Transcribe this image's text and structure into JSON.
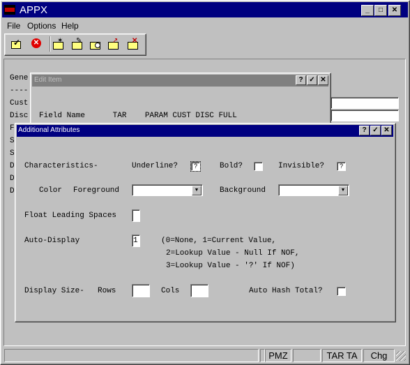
{
  "window": {
    "title": "APPX",
    "icon": "appx-logo-icon"
  },
  "menu": [
    {
      "label": "File"
    },
    {
      "label": "Options"
    },
    {
      "label": "Help"
    }
  ],
  "toolbar": [
    {
      "name": "ok-tool-icon"
    },
    {
      "name": "cancel-tool-icon"
    },
    {
      "name": "new-folder-icon"
    },
    {
      "name": "edit-folder-icon"
    },
    {
      "name": "search-folder-icon"
    },
    {
      "name": "up-folder-icon"
    },
    {
      "name": "delete-folder-icon"
    }
  ],
  "background": {
    "rows": [
      "Gene",
      "----",
      "Cust",
      "Disc",
      "F",
      "S",
      "S",
      "D",
      "D",
      "D"
    ]
  },
  "edit_item": {
    "title": "Edit Item",
    "header": "Field Name      TAR    PARAM CUST DISC FULL"
  },
  "dialog": {
    "title": "Additional Attributes",
    "characteristics_label": "Characteristics-",
    "underline_label": "Underline?",
    "underline_value": "?",
    "bold_label": "Bold?",
    "bold_value": "",
    "invisible_label": "Invisible?",
    "invisible_value": "?",
    "color_label": "Color",
    "foreground_label": "Foreground",
    "foreground_value": "",
    "background_label": "Background",
    "background_value": "",
    "float_label": "Float Leading Spaces",
    "float_value": "",
    "auto_display_label": "Auto-Display",
    "auto_display_value": "1",
    "auto_display_help_1": "(0=None, 1=Current Value,",
    "auto_display_help_2": "2=Lookup Value - Null If NOF,",
    "auto_display_help_3": "3=Lookup Value - '?' If NOF)",
    "display_size_label": "Display Size-",
    "rows_label": "Rows",
    "rows_value": "",
    "cols_label": "Cols",
    "cols_value": "",
    "hash_label": "Auto Hash Total?",
    "hash_value": ""
  },
  "status": {
    "cells": [
      "",
      "",
      "PMZ",
      "",
      "TAR TA",
      "Chg"
    ]
  }
}
